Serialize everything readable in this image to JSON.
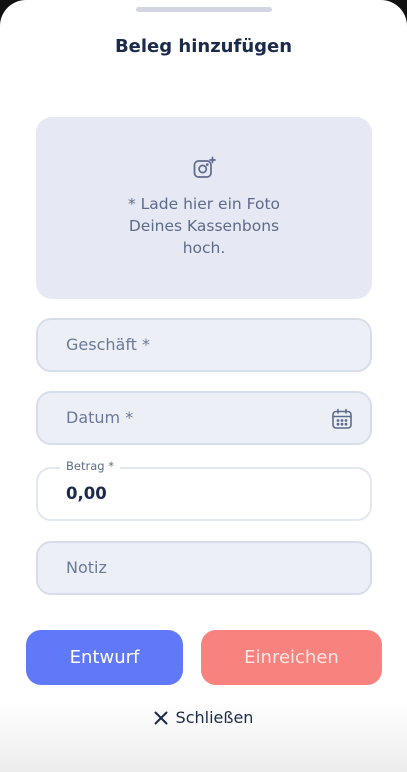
{
  "sheet": {
    "title": "Beleg hinzufügen"
  },
  "upload": {
    "icon": "camera-plus-icon",
    "line1": "* Lade hier ein Foto",
    "line2": "Deines Kassenbons",
    "line3": "hoch."
  },
  "fields": {
    "store_placeholder": "Geschäft *",
    "date_placeholder": "Datum *",
    "date_icon": "calendar-icon",
    "amount_label": "Betrag *",
    "amount_value": "0,00",
    "note_placeholder": "Notiz"
  },
  "actions": {
    "draft_label": "Entwurf",
    "submit_label": "Einreichen",
    "close_label": "Schließen",
    "close_icon": "close-icon"
  },
  "colors": {
    "primary": "#5f79f8",
    "accent": "#f8837e",
    "text_dark": "#1b2a4a",
    "field_bg": "#eceff6"
  }
}
